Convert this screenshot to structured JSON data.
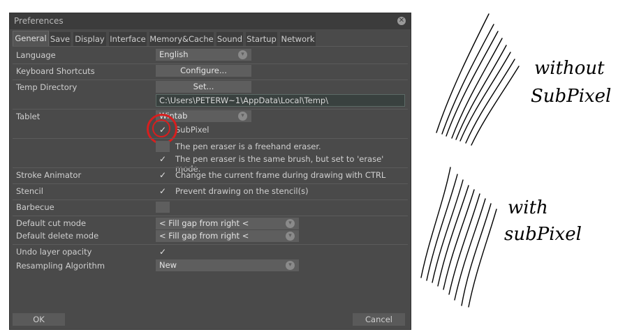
{
  "dialog": {
    "title": "Preferences",
    "close_icon": "close-icon",
    "tabs": [
      "General",
      "Save",
      "Display",
      "Interface",
      "Memory&Cache",
      "Sound",
      "Startup",
      "Network"
    ],
    "active_tab": "General"
  },
  "settings": {
    "language_label": "Language",
    "language_value": "English",
    "shortcuts_label": "Keyboard Shortcuts",
    "configure_button": "Configure...",
    "temp_label": "Temp Directory",
    "set_button": "Set...",
    "temp_path": "C:\\Users\\PETERW~1\\AppData\\Local\\Temp\\",
    "tablet_label": "Tablet",
    "tablet_value": "Wintab",
    "subpixel_label": "SubPixel",
    "subpixel_checked": true,
    "eraser_freehand_text": "The pen eraser is a freehand eraser.",
    "eraser_freehand_checked": false,
    "eraser_same_text": "The pen eraser is the same brush, but set to 'erase' mode.",
    "eraser_same_checked": true,
    "stroke_animator_label": "Stroke Animator",
    "stroke_animator_text": "Change the current frame during drawing with CTRL",
    "stroke_animator_checked": true,
    "stencil_label": "Stencil",
    "stencil_text": "Prevent drawing on the stencil(s)",
    "stencil_checked": true,
    "barbecue_label": "Barbecue",
    "barbecue_checked": false,
    "cut_mode_label": "Default cut mode",
    "cut_mode_value": "< Fill gap from right <",
    "delete_mode_label": "Default delete mode",
    "delete_mode_value": "< Fill gap from right <",
    "undo_opacity_label": "Undo layer opacity",
    "undo_opacity_checked": true,
    "resampling_label": "Resampling Algorithm",
    "resampling_value": "New",
    "check_glyph": "✓",
    "chevron_glyph": "▾"
  },
  "footer": {
    "ok_button": "OK",
    "cancel_button": "Cancel"
  },
  "annotation": {
    "top_caption_line1": "without",
    "top_caption_line2": "SubPixel",
    "bottom_caption_line1": "with",
    "bottom_caption_line2": "subPixel",
    "highlight_color": "#d81e1e"
  }
}
